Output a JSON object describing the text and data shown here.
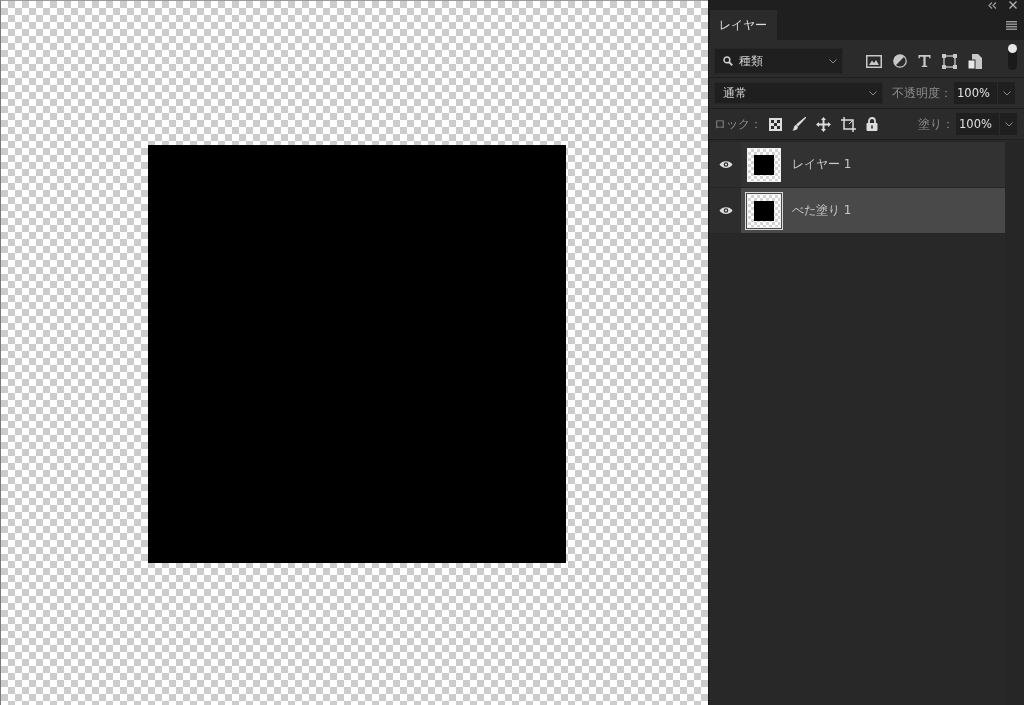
{
  "layers_panel": {
    "tabs": [
      {
        "label": "レイヤー",
        "selected": true
      }
    ],
    "filter": {
      "value": "種類",
      "filtering_on": true
    },
    "blend_mode": {
      "value": "通常"
    },
    "opacity": {
      "label": "不透明度：",
      "value": "100%"
    },
    "lock": {
      "label": "ロック："
    },
    "fill": {
      "label": "塗り：",
      "value": "100%"
    },
    "layers": [
      {
        "name": "レイヤー 1",
        "visible": true,
        "selected": false
      },
      {
        "name": "べた塗り 1",
        "visible": true,
        "selected": true
      }
    ]
  }
}
